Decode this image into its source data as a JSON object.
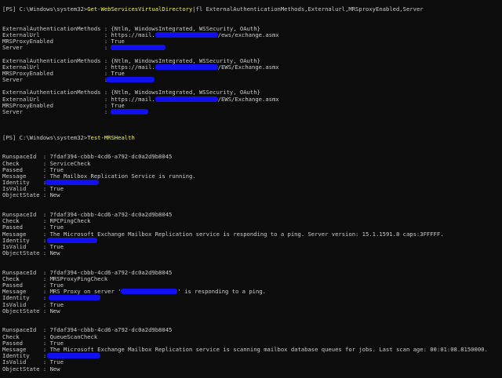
{
  "block1": {
    "prompt": "[PS] C:\\Windows\\system32>",
    "cmdlet": "Get-WebServicesVirtualDirectory",
    "args": "|fl ExternalAuthenticationMethods,Externalurl,MRSproxyEnabled,Server",
    "entries": [
      {
        "l1": "ExternalAuthenticationMethods : {Ntlm, WindowsIntegrated, WSSecurity, OAuth}",
        "l2a": "ExternalUrl                   : https://mail.",
        "l2b": "/ews/exchange.asmx",
        "l3": "MRSProxyEnabled               : True",
        "l4": "Server                        : "
      },
      {
        "l1": "ExternalAuthenticationMethods : {Ntlm, WindowsIntegrated, WSSecurity, OAuth}",
        "l2a": "ExternalUrl                   : https://mail.",
        "l2b": "/EWS/Exchange.asmx",
        "l3": "MRSProxyEnabled               : True",
        "l4": "Server                        : "
      },
      {
        "l1": "ExternalAuthenticationMethods : {Ntlm, WindowsIntegrated, WSSecurity, OAuth}",
        "l2a": "ExternalUrl                   : https://mail.",
        "l2b": "/EWS/Exchange.asmx",
        "l3": "MRSProxyEnabled               : True",
        "l4": "Server                        : "
      }
    ]
  },
  "block2": {
    "prompt": "[PS] C:\\Windows\\system32>",
    "cmdlet": "Test-MRSHealth",
    "results": [
      {
        "runspace": "RunspaceId  : 7fdaf394-cbbb-4cd6-a792-dc0a2d9b8045",
        "check": "Check       : ServiceCheck",
        "passed": "Passed      : True",
        "message": "Message     : The Mailbox Replication Service is running.",
        "identity": "Identity    : ",
        "isvalid": "IsValid     : True",
        "objectstate": "ObjectState : New"
      },
      {
        "runspace": "RunspaceId  : 7fdaf394-cbbb-4cd6-a792-dc0a2d9b8045",
        "check": "Check       : RPCPingCheck",
        "passed": "Passed      : True",
        "message": "Message     : The Microsoft Exchange Mailbox Replication service is responding to a ping. Server version: 15.1.1591.8 caps:3FFFFF.",
        "identity": "Identity    : ",
        "isvalid": "IsValid     : True",
        "objectstate": "ObjectState : New"
      },
      {
        "runspace": "RunspaceId  : 7fdaf394-cbbb-4cd6-a792-dc0a2d9b8045",
        "check": "Check       : MRSProxyPingCheck",
        "passed": "Passed      : True",
        "message_a": "Message     : MRS Proxy on server '",
        "message_b": "' is responding to a ping.",
        "identity": "Identity    : ",
        "isvalid": "IsValid     : True",
        "objectstate": "ObjectState : New"
      },
      {
        "runspace": "RunspaceId  : 7fdaf394-cbbb-4cd6-a792-dc0a2d9b8045",
        "check": "Check       : QueueScanCheck",
        "passed": "Passed      : True",
        "message": "Message     : The Microsoft Exchange Mailbox Replication service is scanning mailbox database queues for jobs. Last scan age: 00:01:08.8150000.",
        "identity": "Identity    : ",
        "isvalid": "IsValid     : True",
        "objectstate": "ObjectState : New"
      }
    ]
  },
  "colors": {
    "background": "#0c0c0c",
    "text": "#cccccc",
    "command": "#f2f25a",
    "redaction": "#1010f0"
  }
}
